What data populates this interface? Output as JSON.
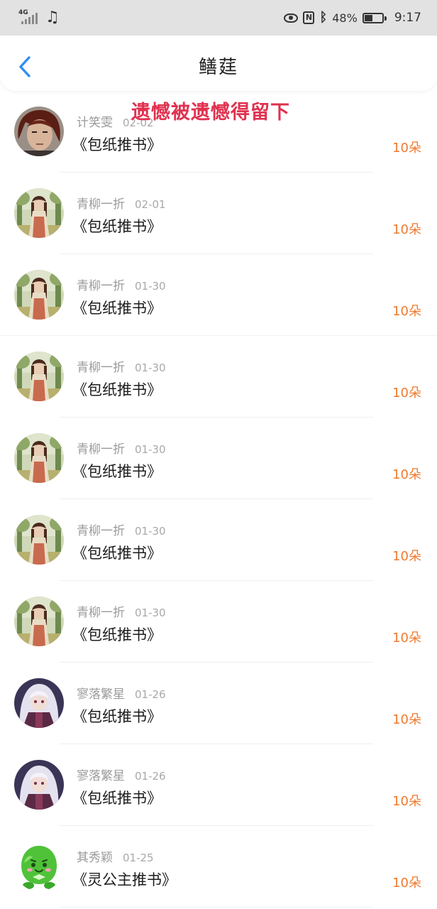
{
  "status_bar": {
    "network": "4G",
    "battery_percent": "48%",
    "battery_level": 0.48,
    "time": "9:17",
    "icons": [
      "signal-icon",
      "music-note-icon",
      "eye-icon",
      "nfc-icon",
      "bluetooth-icon",
      "battery-icon"
    ]
  },
  "header": {
    "title": "鳝莛",
    "back_icon": "chevron-left-icon",
    "accent_color": "#2f8ef5"
  },
  "overlay_caption": "遗憾被遗憾得留下",
  "rows": [
    {
      "name": "计笑雯",
      "date": "02-02",
      "book": "《包纸推书》",
      "amount": "10朵",
      "avatar": "avatar-red-hair"
    },
    {
      "name": "青柳一折",
      "date": "02-01",
      "book": "《包纸推书》",
      "amount": "10朵",
      "avatar": "avatar-anime-girl-forest"
    },
    {
      "name": "青柳一折",
      "date": "01-30",
      "book": "《包纸推书》",
      "amount": "10朵",
      "avatar": "avatar-anime-girl-forest"
    },
    {
      "name": "青柳一折",
      "date": "01-30",
      "book": "《包纸推书》",
      "amount": "10朵",
      "avatar": "avatar-anime-girl-forest"
    },
    {
      "name": "青柳一折",
      "date": "01-30",
      "book": "《包纸推书》",
      "amount": "10朵",
      "avatar": "avatar-anime-girl-forest"
    },
    {
      "name": "青柳一折",
      "date": "01-30",
      "book": "《包纸推书》",
      "amount": "10朵",
      "avatar": "avatar-anime-girl-forest"
    },
    {
      "name": "青柳一折",
      "date": "01-30",
      "book": "《包纸推书》",
      "amount": "10朵",
      "avatar": "avatar-anime-girl-forest"
    },
    {
      "name": "寥落繁星",
      "date": "01-26",
      "book": "《包纸推书》",
      "amount": "10朵",
      "avatar": "avatar-silver-hair-girl"
    },
    {
      "name": "寥落繁星",
      "date": "01-26",
      "book": "《包纸推书》",
      "amount": "10朵",
      "avatar": "avatar-silver-hair-girl"
    },
    {
      "name": "其秀颖",
      "date": "01-25",
      "book": "《灵公主推书》",
      "amount": "10朵",
      "avatar": "avatar-green-creature"
    }
  ],
  "colors": {
    "amount": "#ef7a2e",
    "caption": "#e0314f",
    "status_bar_bg": "#e2e2e2"
  }
}
